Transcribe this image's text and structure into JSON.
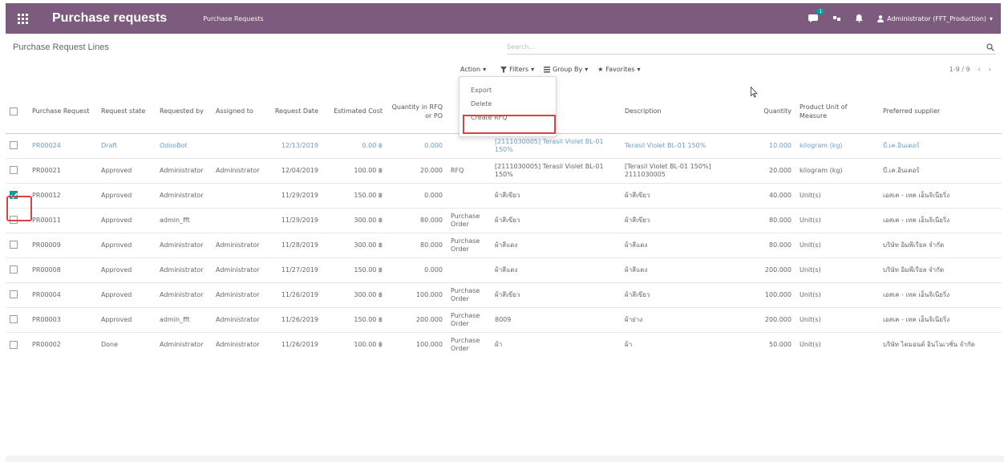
{
  "navbar": {
    "app_title": "Purchase requests",
    "menu": "Purchase Requests",
    "chat_badge": "1",
    "user": "Administrator (FFT_Production)",
    "colors": {
      "bar": "#7c5b7e",
      "accent": "#00a09d"
    }
  },
  "breadcrumb": "Purchase Request Lines",
  "search": {
    "placeholder": "Search..."
  },
  "toolbar": {
    "action": "Action",
    "filters": "Filters",
    "group_by": "Group By",
    "favorites": "Favorites"
  },
  "pager": {
    "range": "1-9 / 9"
  },
  "action_menu": {
    "items": [
      "Export",
      "Delete",
      "Create RFQ"
    ]
  },
  "table": {
    "headers": {
      "purchase_request": "Purchase Request",
      "request_state": "Request state",
      "requested_by": "Requested by",
      "assigned_to": "Assigned to",
      "request_date": "Request Date",
      "estimated_cost": "Estimated Cost",
      "qty_rfq": "Quantity in RFQ or PO",
      "purchase_state": "",
      "product": "",
      "description": "Description",
      "quantity": "Quantity",
      "uom": "Product Unit of Measure",
      "supplier": "Preferred supplier"
    },
    "rows": [
      {
        "pr": "PR00024",
        "state": "Draft",
        "req_by": "OdooBot",
        "assigned": "",
        "date": "12/13/2019",
        "cost": "0.00 ฿",
        "qty_rfq": "0.000",
        "pstate": "",
        "product": "[2111030005] Terasil Violet BL-01 150%",
        "desc": "Terasil Violet BL-01 150%",
        "qty": "10.000",
        "uom": "kilogram (kg)",
        "supplier": "บี.เค.อินเตอร์",
        "checked": false,
        "draft": true
      },
      {
        "pr": "PR00021",
        "state": "Approved",
        "req_by": "Administrator",
        "assigned": "Administrator",
        "date": "12/04/2019",
        "cost": "100.00 ฿",
        "qty_rfq": "20.000",
        "pstate": "RFQ",
        "product": "[2111030005] Terasil Violet BL-01 150%",
        "desc": "[Terasil Violet BL-01 150%] 2111030005",
        "qty": "20.000",
        "uom": "kilogram (kg)",
        "supplier": "บี.เค.อินเตอร์",
        "checked": false,
        "draft": false
      },
      {
        "pr": "PR00012",
        "state": "Approved",
        "req_by": "Administrator",
        "assigned": "",
        "date": "11/29/2019",
        "cost": "150.00 ฿",
        "qty_rfq": "0.000",
        "pstate": "",
        "product": "ผ้าสีเขียว",
        "desc": "ผ้าสีเขียว",
        "qty": "40.000",
        "uom": "Unit(s)",
        "supplier": "เอสเค - เทค เอ็นจิเนียริ่ง",
        "checked": true,
        "draft": false
      },
      {
        "pr": "PR00011",
        "state": "Approved",
        "req_by": "admin_fft",
        "assigned": "",
        "date": "11/29/2019",
        "cost": "300.00 ฿",
        "qty_rfq": "80.000",
        "pstate": "Purchase Order",
        "product": "ผ้าสีเขียว",
        "desc": "ผ้าสีเขียว",
        "qty": "80.000",
        "uom": "Unit(s)",
        "supplier": "เอสเค - เทค เอ็นจิเนียริ่ง",
        "checked": false,
        "draft": false
      },
      {
        "pr": "PR00009",
        "state": "Approved",
        "req_by": "Administrator",
        "assigned": "Administrator",
        "date": "11/28/2019",
        "cost": "300.00 ฿",
        "qty_rfq": "80.000",
        "pstate": "Purchase Order",
        "product": "ผ้าสีแดง",
        "desc": "ผ้าสีแดง",
        "qty": "80.000",
        "uom": "Unit(s)",
        "supplier": "บริษัท อิมพีเรียล จำกัด",
        "checked": false,
        "draft": false
      },
      {
        "pr": "PR00008",
        "state": "Approved",
        "req_by": "Administrator",
        "assigned": "Administrator",
        "date": "11/27/2019",
        "cost": "150.00 ฿",
        "qty_rfq": "0.000",
        "pstate": "",
        "product": "ผ้าสีแดง",
        "desc": "ผ้าสีแดง",
        "qty": "200.000",
        "uom": "Unit(s)",
        "supplier": "บริษัท อิมพีเรียล จำกัด",
        "checked": false,
        "draft": false
      },
      {
        "pr": "PR00004",
        "state": "Approved",
        "req_by": "Administrator",
        "assigned": "Administrator",
        "date": "11/26/2019",
        "cost": "300.00 ฿",
        "qty_rfq": "100.000",
        "pstate": "Purchase Order",
        "product": "ผ้าสีเขียว",
        "desc": "ผ้าสีเขียว",
        "qty": "100.000",
        "uom": "Unit(s)",
        "supplier": "เอสเค - เทค เอ็นจิเนียริ่ง",
        "checked": false,
        "draft": false
      },
      {
        "pr": "PR00003",
        "state": "Approved",
        "req_by": "admin_fft",
        "assigned": "Administrator",
        "date": "11/26/2019",
        "cost": "150.00 ฿",
        "qty_rfq": "200.000",
        "pstate": "Purchase Order",
        "product": "8009",
        "desc": "ผ้าย่าง",
        "qty": "200.000",
        "uom": "Unit(s)",
        "supplier": "เอสเค - เทค เอ็นจิเนียริ่ง",
        "checked": false,
        "draft": false
      },
      {
        "pr": "PR00002",
        "state": "Done",
        "req_by": "Administrator",
        "assigned": "Administrator",
        "date": "11/26/2019",
        "cost": "100.00 ฿",
        "qty_rfq": "100.000",
        "pstate": "Purchase Order",
        "product": "ผ้า",
        "desc": "ผ้า",
        "qty": "50.000",
        "uom": "Unit(s)",
        "supplier": "บริษัท ไดมอนด์ อินโนเวชั่น จำกัด",
        "checked": false,
        "draft": false
      }
    ]
  }
}
